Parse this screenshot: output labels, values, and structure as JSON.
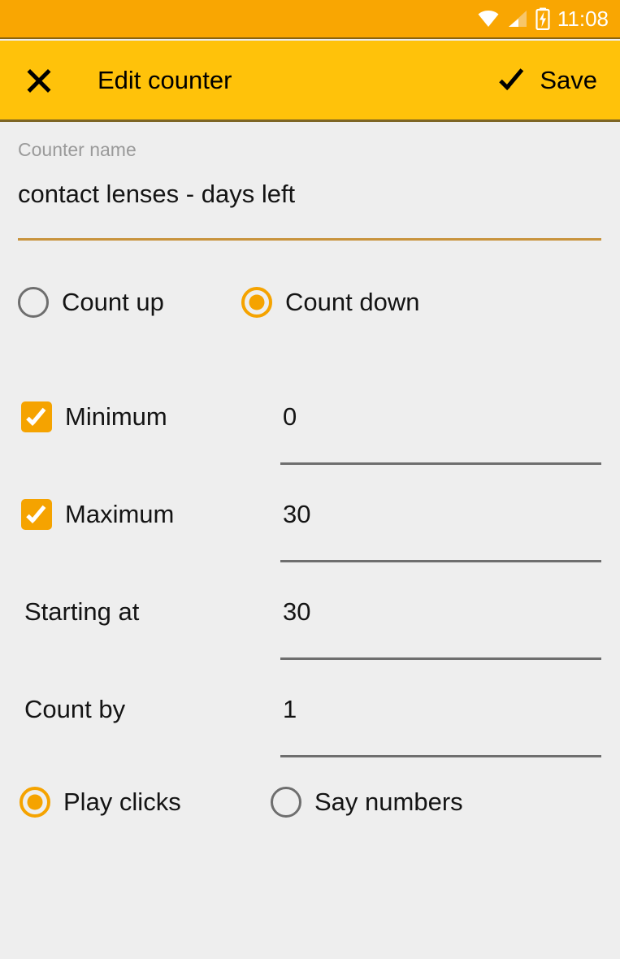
{
  "statusbar": {
    "time": "11:08",
    "icons": [
      "wifi-icon",
      "cellular-signal-icon",
      "battery-charging-icon"
    ]
  },
  "toolbar": {
    "close_icon": "close-icon",
    "title": "Edit counter",
    "save_icon": "check-icon",
    "save_label": "Save",
    "background_color": "#FFC20A"
  },
  "form": {
    "name_field": {
      "label": "Counter name",
      "value": "contact lenses - days left",
      "underline_color": "#c8933c"
    },
    "direction": {
      "options": [
        {
          "label": "Count up",
          "selected": false
        },
        {
          "label": "Count down",
          "selected": true
        }
      ]
    },
    "rows": [
      {
        "label": "Minimum",
        "has_checkbox": true,
        "checked": true,
        "value": "0"
      },
      {
        "label": "Maximum",
        "has_checkbox": true,
        "checked": true,
        "value": "30"
      },
      {
        "label": "Starting at",
        "has_checkbox": false,
        "checked": false,
        "value": "30"
      },
      {
        "label": "Count by",
        "has_checkbox": false,
        "checked": false,
        "value": "1"
      }
    ],
    "sound": {
      "options": [
        {
          "label": "Play clicks",
          "selected": true
        },
        {
          "label": "Say numbers",
          "selected": false
        }
      ]
    }
  },
  "colors": {
    "status_bar": "#F9A602",
    "toolbar": "#FFC20A",
    "accent": "#F5A300",
    "background": "#eeeeee",
    "text": "#141414",
    "muted_text": "#9a9a9a",
    "underline_gray": "#6e6e6e"
  }
}
